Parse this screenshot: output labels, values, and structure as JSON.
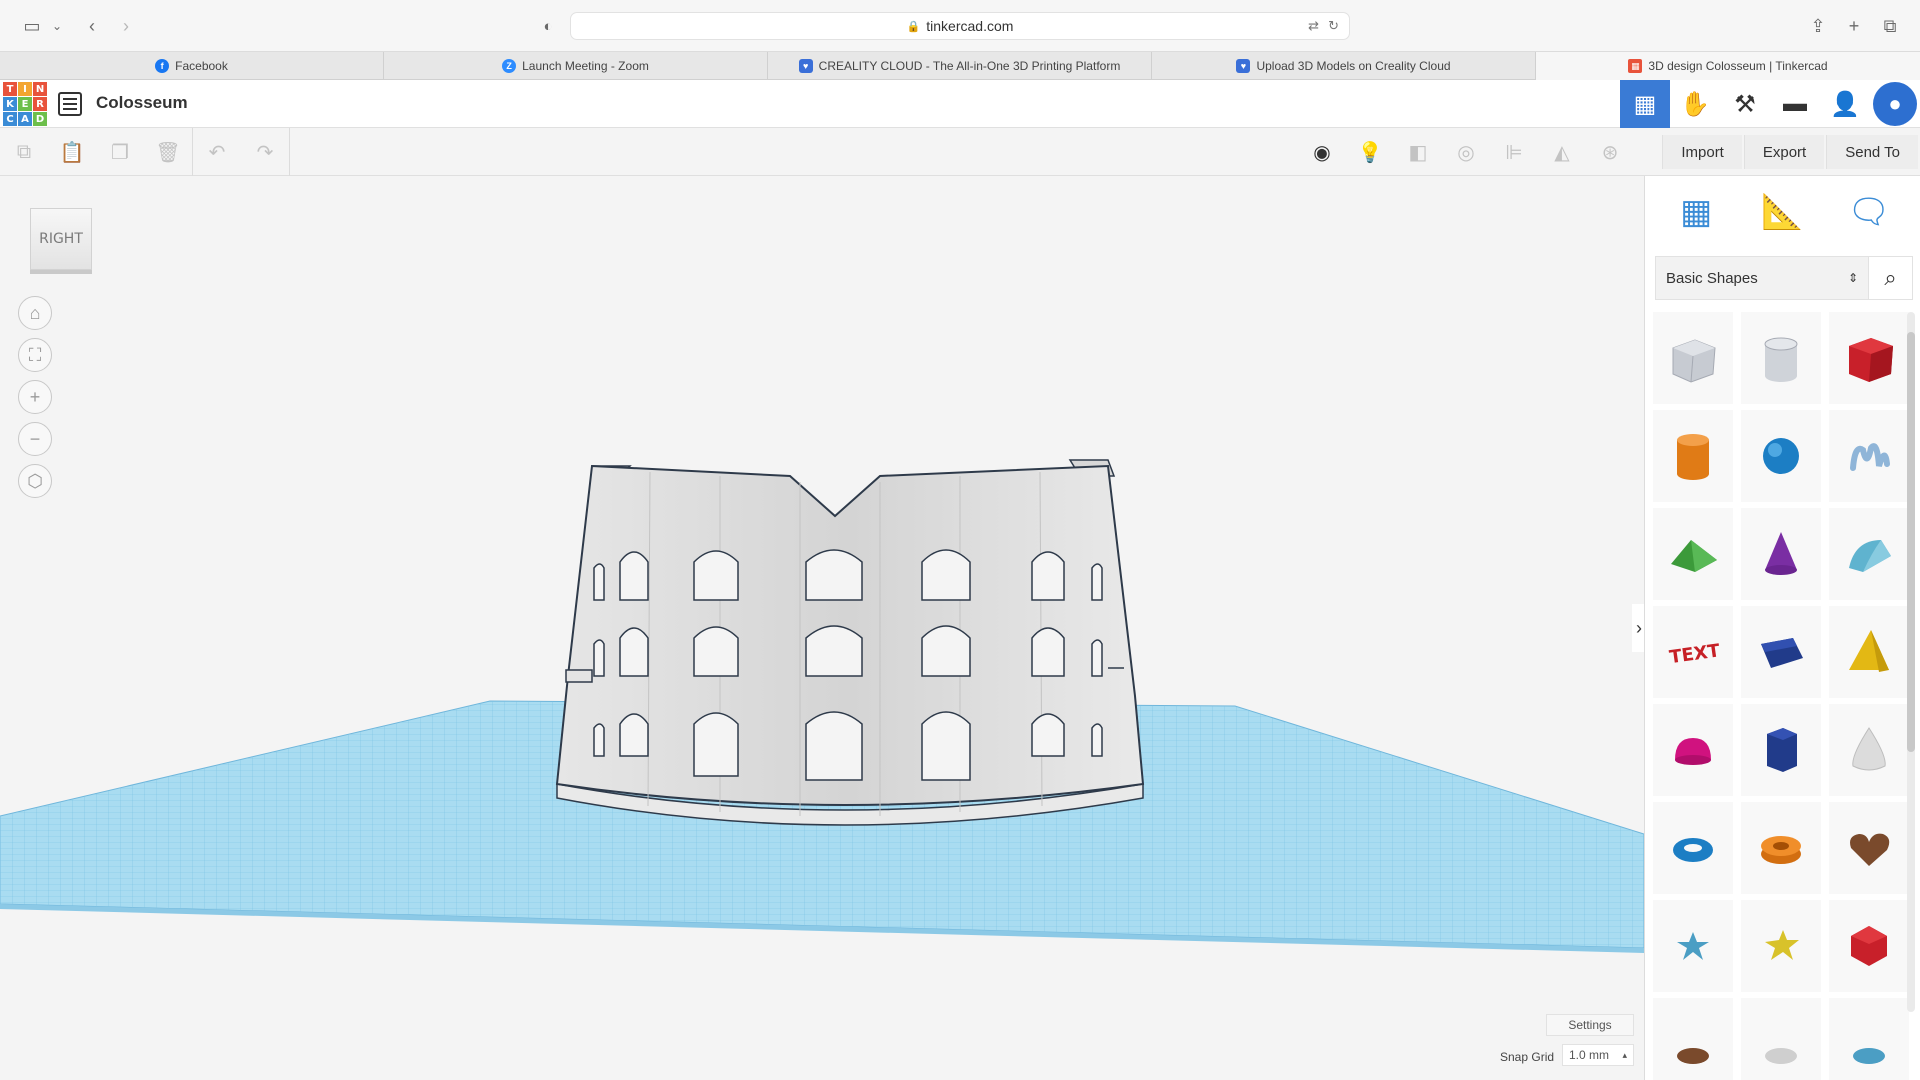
{
  "browser": {
    "url": "tinkercad.com",
    "tabs": [
      {
        "label": "Facebook",
        "icon": "facebook-icon",
        "color": "#1877f2"
      },
      {
        "label": "Launch Meeting - Zoom",
        "icon": "zoom-icon",
        "color": "#2d8cff"
      },
      {
        "label": "CREALITY CLOUD - The All-in-One 3D Printing Platform",
        "icon": "creality-icon",
        "color": "#3a6fd8"
      },
      {
        "label": "Upload 3D Models on Creality Cloud",
        "icon": "creality-icon",
        "color": "#3a6fd8"
      },
      {
        "label": "3D design Colosseum | Tinkercad",
        "icon": "tinkercad-icon",
        "color": "#e8533b",
        "active": true
      }
    ]
  },
  "app": {
    "logo_letters": [
      "T",
      "I",
      "N",
      "K",
      "E",
      "R",
      "C",
      "A",
      "D"
    ],
    "logo_colors": [
      "#e8533b",
      "#f3a531",
      "#e8533b",
      "#3b8cd6",
      "#6dbf4b",
      "#e8533b",
      "#3b8cd6",
      "#3b8cd6",
      "#6dbf4b"
    ],
    "design_name": "Colosseum"
  },
  "toolbar": {
    "import_label": "Import",
    "export_label": "Export",
    "send_to_label": "Send To"
  },
  "viewport": {
    "view_cube_label": "RIGHT",
    "settings_label": "Settings",
    "snap_grid_label": "Snap Grid",
    "snap_grid_value": "1.0 mm"
  },
  "shapes_panel": {
    "category": "Basic Shapes",
    "shapes": [
      "box-hole-icon",
      "cylinder-hole-icon",
      "box-icon",
      "cylinder-icon",
      "sphere-icon",
      "scribble-icon",
      "roof-icon",
      "cone-icon",
      "round-roof-icon",
      "text-icon",
      "half-sphere-shape-icon",
      "pyramid-icon",
      "half-sphere-icon",
      "polygon-icon",
      "paraboloid-icon",
      "torus-icon",
      "tube-icon",
      "heart-icon",
      "star-icon",
      "star-yellow-icon",
      "icosahedron-icon"
    ]
  },
  "colors": {
    "accent": "#3a7bd5",
    "workplane": "#8fd0ec"
  }
}
